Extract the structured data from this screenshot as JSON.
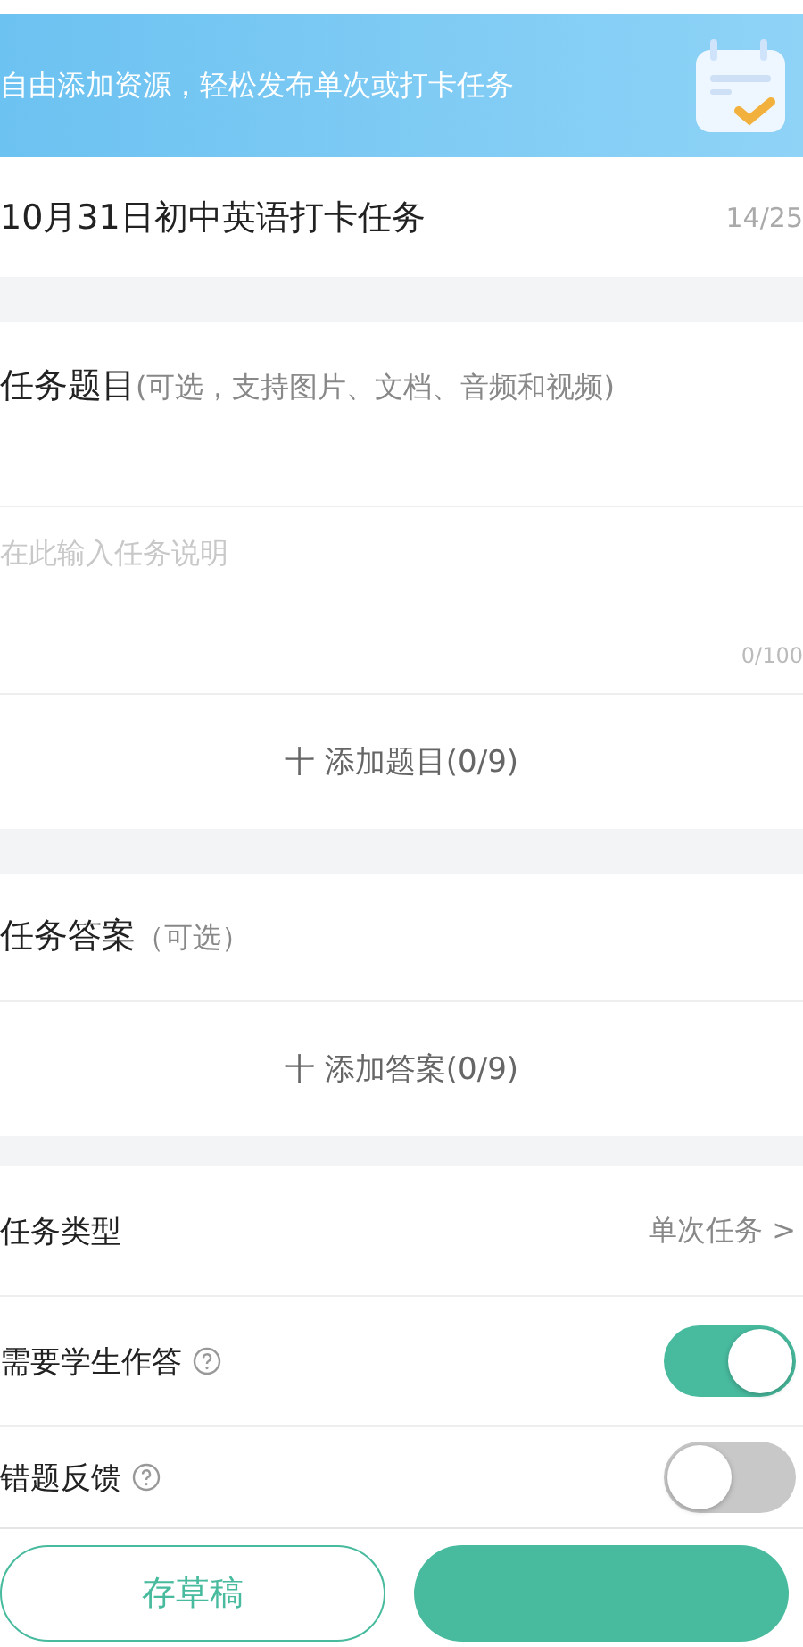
{
  "banner": {
    "text": "自由添加资源，轻松发布单次或打卡任务"
  },
  "title_field": {
    "value": "10月31日初中英语打卡任务",
    "counter": "14/25"
  },
  "question_section": {
    "title": "任务题目",
    "hint": "(可选，支持图片、文档、音频和视频)",
    "input": {
      "placeholder": "在此输入任务说明",
      "counter": "0/100"
    },
    "add_button": {
      "icon": "十",
      "label": "添加题目(0/9)"
    }
  },
  "answer_section": {
    "title": "任务答案",
    "hint": "（可选）",
    "add_button": {
      "icon": "十",
      "label": "添加答案(0/9)"
    }
  },
  "settings": [
    {
      "kind": "select",
      "label": "任务类型",
      "value": "单次任务",
      "chevron": ">"
    },
    {
      "kind": "toggle",
      "label": "需要学生作答",
      "help": true,
      "on": true
    },
    {
      "kind": "toggle",
      "label": "错题反馈",
      "help": true,
      "on": false
    }
  ],
  "footer": {
    "draft_button": "存草稿"
  }
}
